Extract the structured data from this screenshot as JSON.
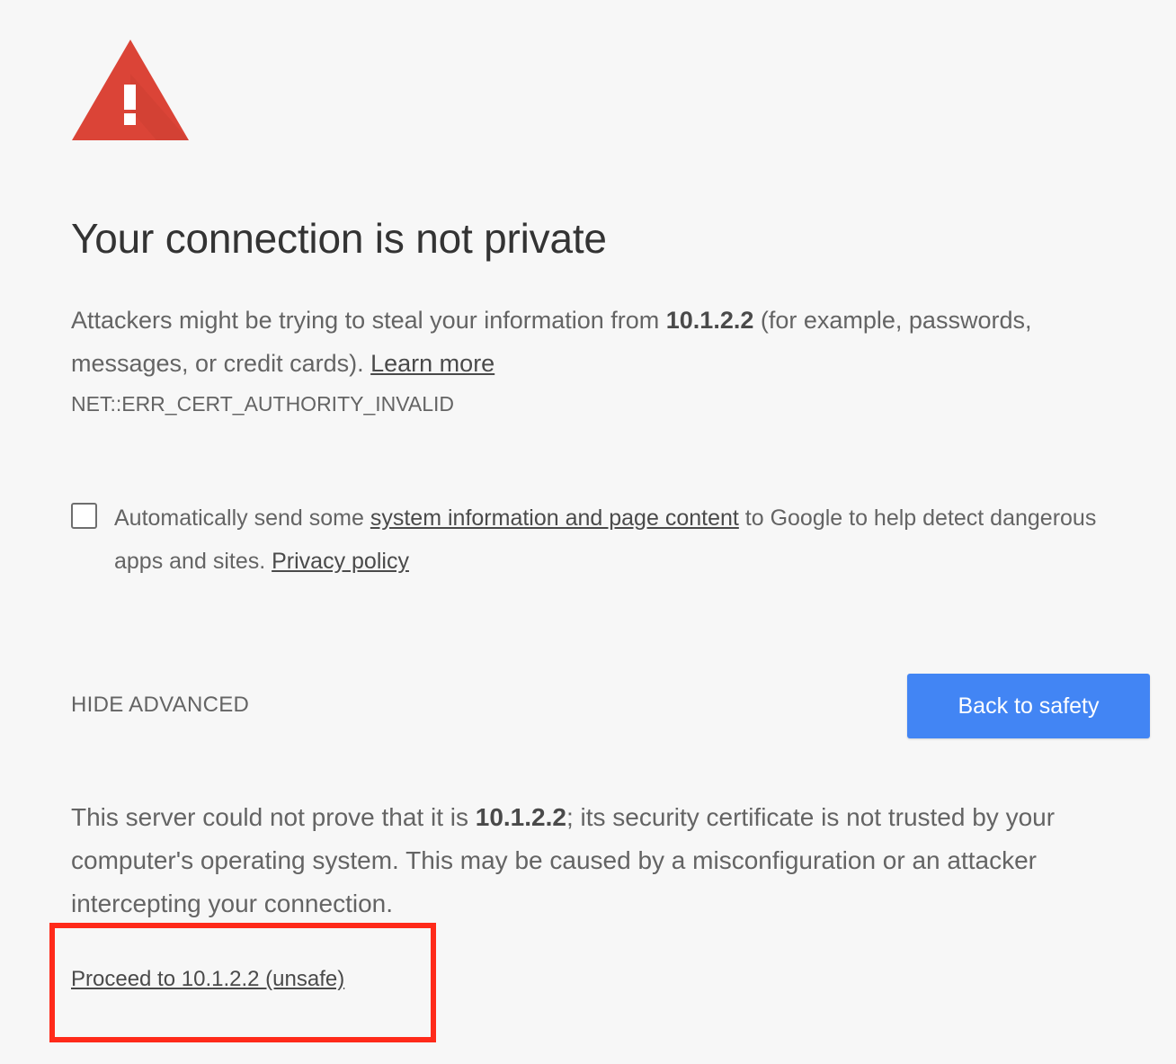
{
  "heading": "Your connection is not private",
  "main_message": {
    "text_before_host": "Attackers might be trying to steal your information from ",
    "host": "10.1.2.2",
    "text_after_host": " (for example, passwords, messages, or credit cards). ",
    "learn_more": "Learn more"
  },
  "error_code": "NET::ERR_CERT_AUTHORITY_INVALID",
  "extended_reporting": {
    "checked": false,
    "text_before_link": "Automatically send some ",
    "link_text": "system information and page content",
    "text_after_link": " to Google to help detect dangerous apps and sites. ",
    "privacy_policy": "Privacy policy"
  },
  "buttons": {
    "hide_advanced": "HIDE ADVANCED",
    "back_to_safety": "Back to safety"
  },
  "details": {
    "text_before_host": "This server could not prove that it is ",
    "host": "10.1.2.2",
    "text_after_host": "; its security certificate is not trusted by your computer's operating system. This may be caused by a misconfiguration or an attacker intercepting your connection."
  },
  "proceed_link": "Proceed to 10.1.2.2 (unsafe)",
  "colors": {
    "background": "#f7f7f7",
    "warning_red": "#db4437",
    "primary_button": "#4285f4",
    "annotation_box": "#ff2a1a"
  },
  "icons": {
    "warning": "warning-triangle-icon"
  }
}
